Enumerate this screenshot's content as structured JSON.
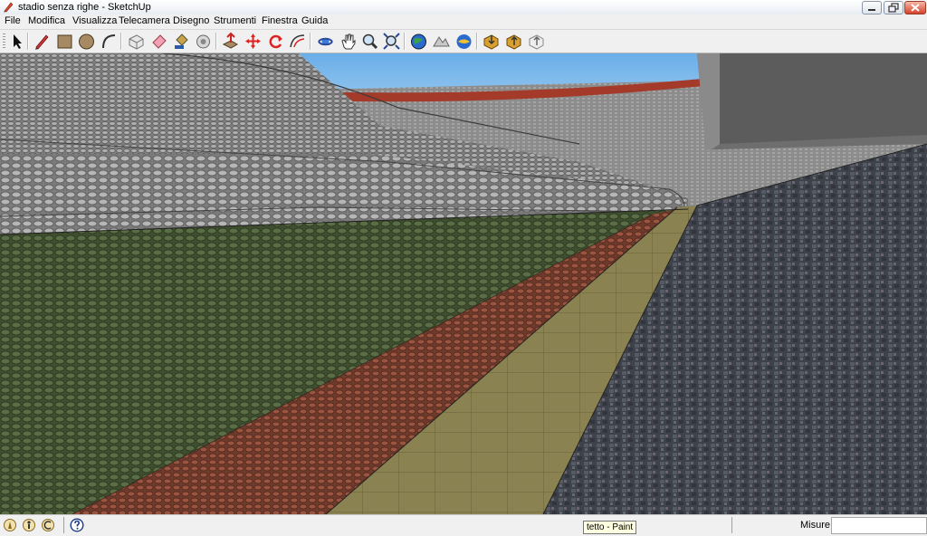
{
  "window": {
    "title": "stadio senza righe - SketchUp"
  },
  "menu": {
    "items": [
      "File",
      "Modifica",
      "Visualizza",
      "Telecamera",
      "Disegno",
      "Strumenti",
      "Finestra",
      "Guida"
    ]
  },
  "toolbar": {
    "tools": [
      "select-icon",
      "pencil-line-icon",
      "rectangle-icon",
      "circle-icon",
      "arc-icon",
      "make-component-icon",
      "eraser-icon",
      "paint-bucket-icon",
      "tape-measure-icon",
      "push-pull-icon",
      "move-icon",
      "rotate-icon",
      "offset-icon",
      "orbit-icon",
      "pan-icon",
      "zoom-icon",
      "zoom-extents-icon",
      "add-location-icon",
      "toggle-terrain-icon",
      "preview-google-earth-icon",
      "get-models-icon",
      "share-model-icon",
      "share-component-icon"
    ]
  },
  "status": {
    "hint_text": "tetto - Paint",
    "measure_label": "Misure",
    "measure_value": ""
  },
  "colors": {
    "sky": "#7ab4e8",
    "field_green": "#4a5a3a",
    "track_red": "#8a4a3a",
    "path_beige": "#8a8050",
    "roof_grey": "#9a9a9a"
  }
}
